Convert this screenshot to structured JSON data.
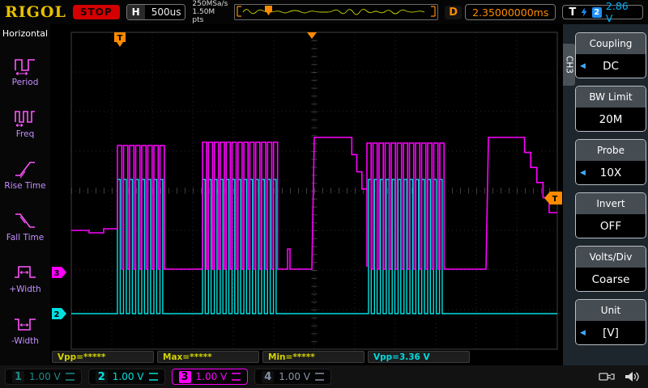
{
  "topbar": {
    "brand": "RIGOL",
    "run_state": "STOP",
    "horizontal_label": "H",
    "timebase": "500us",
    "sample_rate": "250MSa/s",
    "memory_depth": "1.50M pts",
    "delay_label": "D",
    "delay_value": "2.35000000ms",
    "trigger_label": "T",
    "trigger_source": "2",
    "trigger_level": "2.86 V"
  },
  "left_menu": {
    "title": "Horizontal",
    "items": [
      {
        "label": "Period",
        "icon": "period-icon"
      },
      {
        "label": "Freq",
        "icon": "freq-icon"
      },
      {
        "label": "Rise Time",
        "icon": "rise-time-icon"
      },
      {
        "label": "Fall Time",
        "icon": "fall-time-icon"
      },
      {
        "label": "+Width",
        "icon": "plus-width-icon"
      },
      {
        "label": "-Width",
        "icon": "minus-width-icon"
      }
    ]
  },
  "scope": {
    "trigger_position_flag": "T",
    "trigger_level_tag": "T",
    "ch3_marker": "3",
    "ch2_marker": "2"
  },
  "measurements": [
    {
      "label": "Vpp=*****",
      "color": "#d4d400"
    },
    {
      "label": "Max=*****",
      "color": "#d4d400"
    },
    {
      "label": "Min=*****",
      "color": "#d4d400"
    },
    {
      "label": "Vpp=3.36 V",
      "color": "#00dce0"
    }
  ],
  "right_menu": {
    "tab": "CH3",
    "items": [
      {
        "title": "Coupling",
        "value": "DC",
        "arrow": true
      },
      {
        "title": "BW Limit",
        "value": "20M",
        "arrow": false
      },
      {
        "title": "Probe",
        "value": "10X",
        "arrow": true
      },
      {
        "title": "Invert",
        "value": "OFF",
        "arrow": false
      },
      {
        "title": "Volts/Div",
        "value": "Coarse",
        "arrow": false
      },
      {
        "title": "Unit",
        "value": "[V]",
        "arrow": true
      }
    ]
  },
  "statusbar": {
    "channels": [
      {
        "num": "1",
        "scale": "1.00 V",
        "color": "#1f8a8a",
        "selected": false
      },
      {
        "num": "2",
        "scale": "1.00 V",
        "color": "#00e0e0",
        "selected": false
      },
      {
        "num": "3",
        "scale": "1.00 V",
        "color": "#ff00ff",
        "selected": true
      },
      {
        "num": "4",
        "scale": "1.00 V",
        "color": "#8892a8",
        "selected": false
      }
    ]
  },
  "colors": {
    "brand_yellow": "#e8c000",
    "stop_red": "#d40000",
    "marker_orange": "#ff8a00",
    "trigger_blue": "#00b4ff",
    "ch2_cyan": "#00e0e0",
    "ch3_magenta": "#ff00ff",
    "left_menu_label": "#c490ff"
  },
  "waveforms": {
    "ch2": {
      "color": "#00e0e0",
      "width": 1.4,
      "segments": [
        [
          "M",
          26,
          358
        ],
        [
          "H",
          83
        ],
        [
          "B",
          143,
          8,
          192,
          358,
          0.45
        ],
        [
          "H",
          188
        ],
        [
          "B",
          283,
          13,
          192,
          358,
          0.45
        ],
        [
          "H",
          393
        ],
        [
          "B",
          488,
          13,
          192,
          358,
          0.45
        ],
        [
          "H",
          626
        ]
      ]
    },
    "ch3": {
      "color": "#ff00ff",
      "width": 1.6,
      "segments": [
        [
          "M",
          26,
          255
        ],
        [
          "H",
          48
        ],
        [
          "L",
          48,
          258
        ],
        [
          "H",
          66
        ],
        [
          "L",
          66,
          253
        ],
        [
          "H",
          83
        ],
        [
          "B",
          143,
          8,
          150,
          303,
          0.7
        ],
        [
          "H",
          188
        ],
        [
          "B",
          283,
          13,
          146,
          303,
          0.7
        ],
        [
          "H",
          293
        ],
        [
          "L",
          293,
          278
        ],
        [
          "H",
          296
        ],
        [
          "L",
          296,
          303
        ],
        [
          "H",
          323
        ],
        [
          "L",
          326,
          140
        ],
        [
          "H",
          366
        ],
        [
          "S",
          391,
          225,
          4
        ],
        [
          "L",
          391,
          300
        ],
        [
          "B",
          488,
          13,
          147,
          303,
          0.7
        ],
        [
          "H",
          538
        ],
        [
          "L",
          541,
          140
        ],
        [
          "H",
          578
        ],
        [
          "S",
          616,
          233,
          5
        ],
        [
          "H",
          626
        ]
      ]
    }
  }
}
